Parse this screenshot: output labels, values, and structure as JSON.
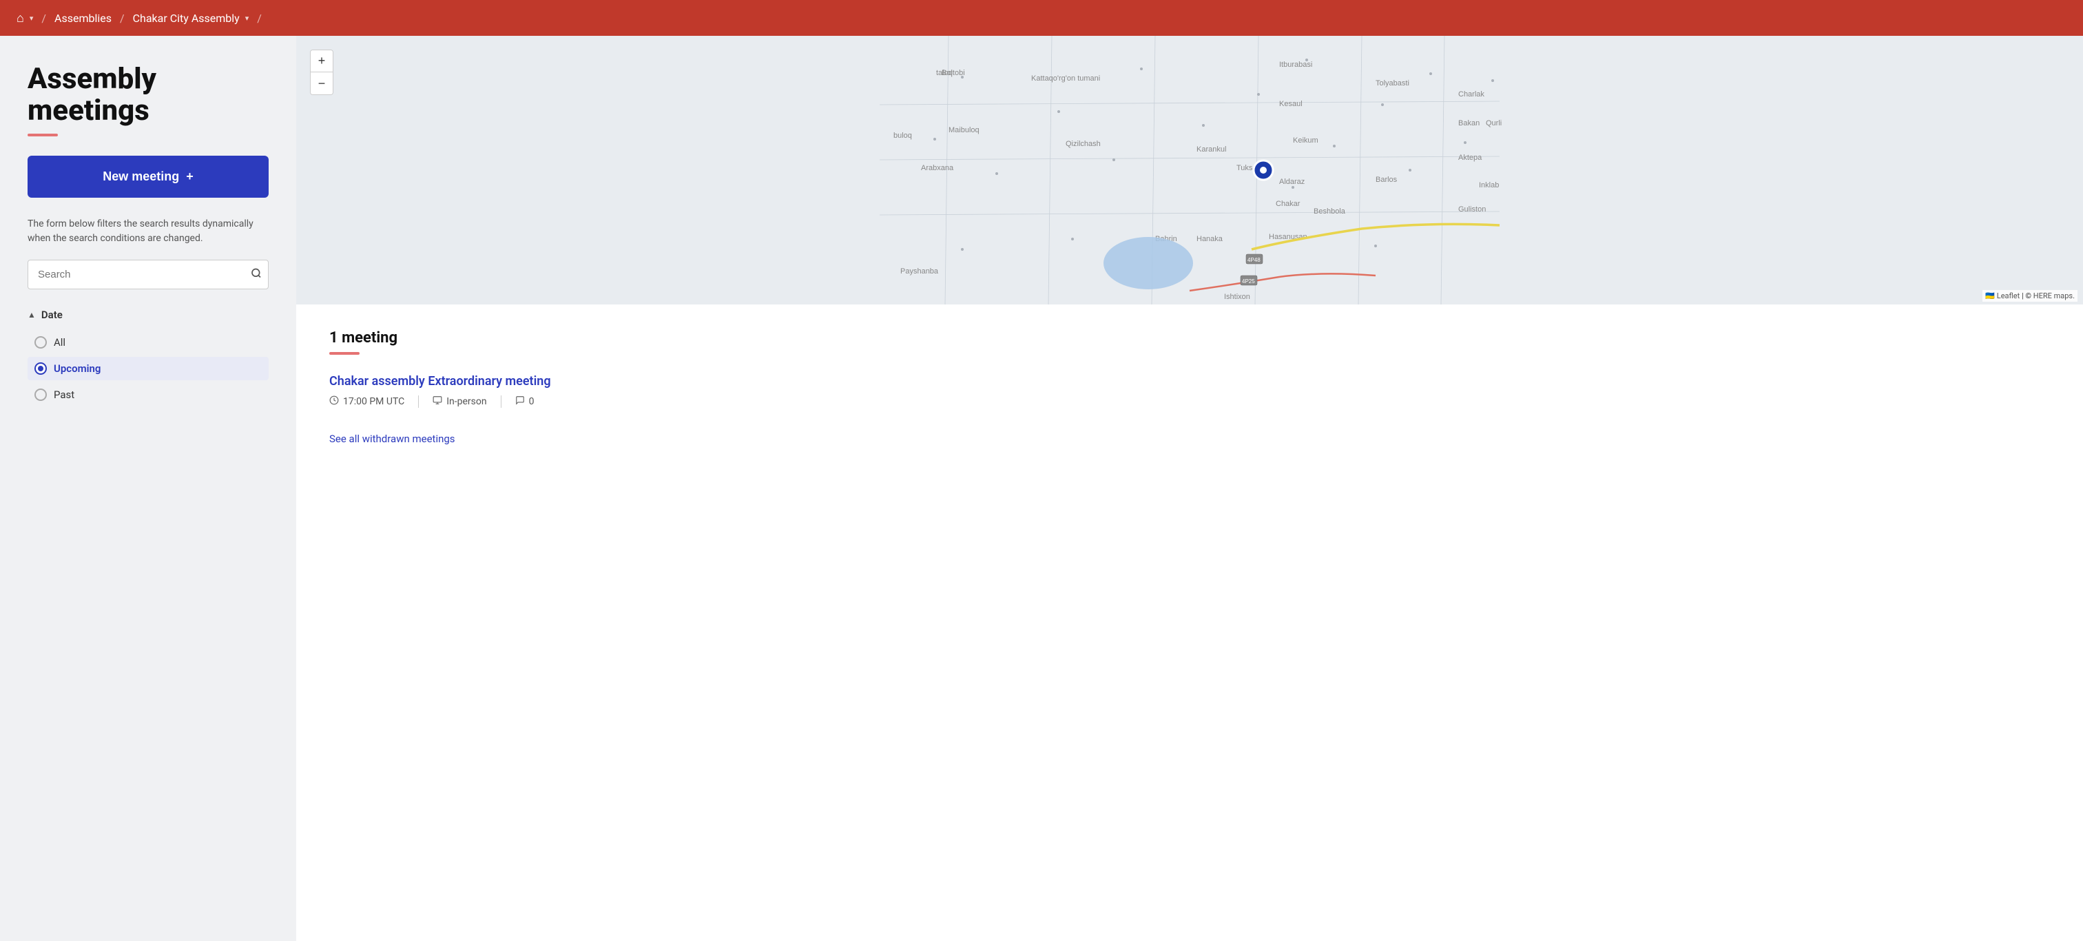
{
  "topbar": {
    "home_icon": "⌂",
    "separator1": "/",
    "assemblies_label": "Assemblies",
    "separator2": "/",
    "assembly_name": "Chakar City Assembly",
    "separator3": "/"
  },
  "sidebar": {
    "page_title": "Assembly meetings",
    "new_meeting_label": "New meeting",
    "new_meeting_icon": "+",
    "filter_description": "The form below filters the search results dynamically when the search conditions are changed.",
    "search_placeholder": "Search",
    "date_filter_label": "Date",
    "radio_options": [
      {
        "label": "All",
        "value": "all",
        "active": false
      },
      {
        "label": "Upcoming",
        "value": "upcoming",
        "active": true
      },
      {
        "label": "Past",
        "value": "past",
        "active": false
      }
    ]
  },
  "map": {
    "zoom_in": "+",
    "zoom_out": "−",
    "attribution": "Leaflet | © HERE maps."
  },
  "meetings": {
    "count_label": "1 meeting",
    "items": [
      {
        "title": "Chakar assembly Extraordinary meeting",
        "time": "17:00 PM UTC",
        "type": "In-person",
        "comments": "0"
      }
    ],
    "see_withdrawn_label": "See all withdrawn meetings"
  }
}
